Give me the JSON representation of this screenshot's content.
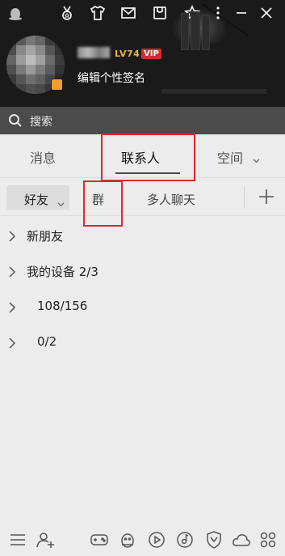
{
  "profile": {
    "level": "LV74",
    "vip": "VIP",
    "signature": "编辑个性签名"
  },
  "topbar_icons": [
    "qq-penguin-icon",
    "medal-icon",
    "shirt-icon",
    "mail-icon",
    "wallet-icon",
    "star-icon",
    "more-icon",
    "close-icon"
  ],
  "search": {
    "label": "搜索"
  },
  "tabs": {
    "messages": "消息",
    "contacts": "联系人",
    "space": "空间"
  },
  "subtabs": {
    "friends": "好友",
    "groups": "群",
    "multi_chat": "多人聊天"
  },
  "groups": [
    {
      "label": "新朋友"
    },
    {
      "label": "我的设备 2/3"
    },
    {
      "label": "108/156"
    },
    {
      "label": "0/2"
    }
  ],
  "bottom_icons": [
    "menu-icon",
    "add-contact-icon",
    "game-icon",
    "penguin-pet-icon",
    "video-icon",
    "music-icon",
    "shield-icon",
    "cloud-icon",
    "apps-icon"
  ],
  "colors": {
    "header_bg": "#1a1a1a",
    "search_bg": "#4b4b4b",
    "body_bg": "#ececec",
    "highlight": "#e0262c",
    "level": "#e9b640",
    "vip_bg": "#d62c2c"
  }
}
